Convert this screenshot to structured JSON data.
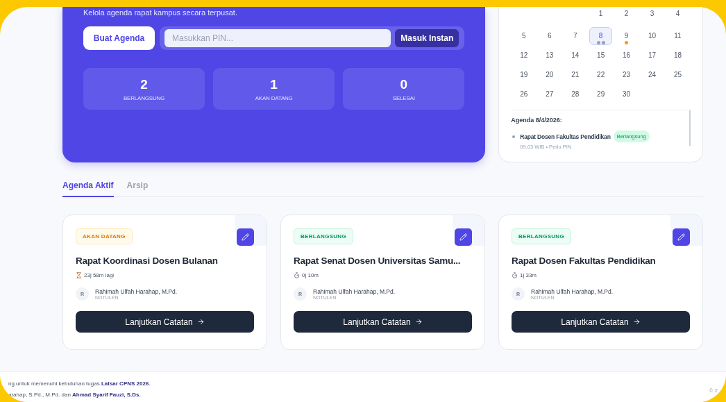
{
  "hero": {
    "subtitle": "Kelola agenda rapat kampus secara terpusat.",
    "create_button": "Buat Agenda",
    "pin_field": {
      "placeholder": "Masukkan PIN..."
    },
    "join_button": "Masuk Instan",
    "stats": [
      {
        "value": "2",
        "label": "BERLANGSUNG"
      },
      {
        "value": "1",
        "label": "AKAN DATANG"
      },
      {
        "value": "0",
        "label": "SELESAI"
      }
    ]
  },
  "calendar": {
    "weeks": [
      {
        "days": [
          {
            "label": "1",
            "selected": false
          },
          {
            "label": "2",
            "selected": false
          },
          {
            "label": "3",
            "selected": false
          },
          {
            "label": "4",
            "selected": false
          }
        ]
      },
      {
        "days": [
          {
            "label": "5",
            "selected": false
          },
          {
            "label": "6",
            "selected": false
          },
          {
            "label": "7",
            "selected": false
          },
          {
            "label": "8",
            "selected": true,
            "dots": [
              {
                "color": "#9ca3af"
              },
              {
                "color": "#9ca3af"
              }
            ]
          },
          {
            "label": "9",
            "selected": false,
            "dots": [
              {
                "color": "#f59e0b"
              }
            ]
          },
          {
            "label": "10",
            "selected": false
          },
          {
            "label": "11",
            "selected": false
          }
        ]
      },
      {
        "days": [
          {
            "label": "12",
            "selected": false
          },
          {
            "label": "13",
            "selected": false
          },
          {
            "label": "14",
            "selected": false
          },
          {
            "label": "15",
            "selected": false
          },
          {
            "label": "16",
            "selected": false
          },
          {
            "label": "17",
            "selected": false
          },
          {
            "label": "18",
            "selected": false
          }
        ]
      },
      {
        "days": [
          {
            "label": "19",
            "selected": false
          },
          {
            "label": "20",
            "selected": false
          },
          {
            "label": "21",
            "selected": false
          },
          {
            "label": "22",
            "selected": false
          },
          {
            "label": "23",
            "selected": false
          },
          {
            "label": "24",
            "selected": false
          },
          {
            "label": "25",
            "selected": false
          }
        ]
      },
      {
        "days": [
          {
            "label": "26",
            "selected": false
          },
          {
            "label": "27",
            "selected": false
          },
          {
            "label": "28",
            "selected": false
          },
          {
            "label": "29",
            "selected": false
          },
          {
            "label": "30",
            "selected": false
          }
        ]
      }
    ],
    "agenda_title": "Agenda 8/4/2026:",
    "agenda_items": [
      {
        "title": "Rapat Dosen Fakultas Pendidikan",
        "status": "Berlangsung",
        "meta": "09.03 WIB • Perlu PIN"
      }
    ]
  },
  "tabs": [
    {
      "label": "Agenda Aktif",
      "selected": true
    },
    {
      "label": "Arsip",
      "selected": false
    }
  ],
  "cards": [
    {
      "status": "AKAN DATANG",
      "kind": "upcoming",
      "title": "Rapat Koordinasi Dosen Bulanan",
      "time": "23j 58m lagi",
      "initial": "R",
      "person": "Rahimah Ulfah Harahap, M.Pd.",
      "role": "NOTULEN",
      "button": "Lanjutkan Catatan"
    },
    {
      "status": "BERLANGSUNG",
      "kind": "ongoing",
      "title": "Rapat Senat Dosen Universitas Samu...",
      "time": "0j 10m",
      "initial": "R",
      "person": "Rahimah Ulfah Harahap, M.Pd.",
      "role": "NOTULEN",
      "button": "Lanjutkan Catatan"
    },
    {
      "status": "BERLANGSUNG",
      "kind": "ongoing",
      "title": "Rapat Dosen Fakultas Pendidikan",
      "time": "1j 33m",
      "initial": "R",
      "person": "Rahimah Ulfah Harahap, M.Pd.",
      "role": "NOTULEN",
      "button": "Lanjutkan Catatan"
    }
  ],
  "footer": {
    "line_1": "ng untuk memenuhi kebutuhan tugas **Latsar CPNS 2026**.",
    "line_2": "arahap, S.Pd., M.Pd. dan **Ahmad Syarif Fauzi, S.Ds.**",
    "copyright": "© 2"
  }
}
